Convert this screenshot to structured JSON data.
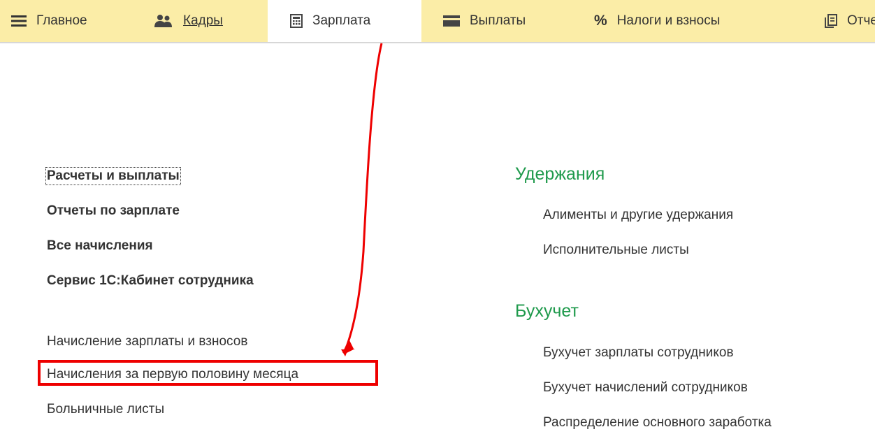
{
  "nav": {
    "tabs": [
      {
        "label": "Главное",
        "icon": "hamburger-menu-icon"
      },
      {
        "label": "Кадры",
        "icon": "people-icon"
      },
      {
        "label": "Зарплата",
        "icon": "calculator-icon"
      },
      {
        "label": "Выплаты",
        "icon": "wallet-card-icon"
      },
      {
        "label": "Налоги и взносы",
        "icon": "percent-icon",
        "glyph": "%"
      },
      {
        "label": "Отчеты",
        "icon": "documents-icon"
      }
    ]
  },
  "main": {
    "left_bold_items": [
      {
        "label": "Расчеты и выплаты"
      },
      {
        "label": "Отчеты по зарплате"
      },
      {
        "label": "Все начисления"
      },
      {
        "label": "Сервис 1С:Кабинет сотрудника"
      }
    ],
    "left_items": [
      {
        "label": "Начисление зарплаты и взносов"
      },
      {
        "label": "Начисления за первую половину месяца"
      },
      {
        "label": "Больничные листы"
      }
    ],
    "sections": [
      {
        "title": "Удержания",
        "items": [
          {
            "label": "Алименты и другие удержания"
          },
          {
            "label": "Исполнительные листы"
          }
        ]
      },
      {
        "title": "Бухучет",
        "items": [
          {
            "label": "Бухучет зарплаты сотрудников"
          },
          {
            "label": "Бухучет начислений сотрудников"
          },
          {
            "label": "Распределение основного заработка"
          }
        ]
      }
    ]
  },
  "annotation": {
    "color": "#ee0000"
  },
  "colors": {
    "topbar": "#fbeda7",
    "section_title": "#1f9a4c",
    "text": "#333333"
  }
}
